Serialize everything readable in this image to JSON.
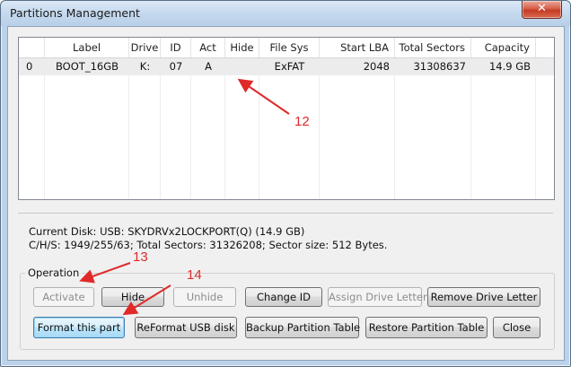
{
  "window": {
    "title": "Partitions Management",
    "close_glyph": "✕"
  },
  "table": {
    "columns": [
      "",
      "Label",
      "Drive",
      "ID",
      "Act",
      "Hide",
      "File Sys",
      "Start LBA",
      "Total Sectors",
      "Capacity"
    ],
    "rows": [
      {
        "index": "0",
        "label": "BOOT_16GB",
        "drive": "K:",
        "id": "07",
        "act": "A",
        "hide": "",
        "fs": "ExFAT",
        "start_lba": "2048",
        "total_sectors": "31308637",
        "capacity": "14.9 GB"
      }
    ]
  },
  "disk_info": {
    "line1": "Current Disk:  USB: SKYDRVx2LOCKPORT(Q) (14.9 GB)",
    "line2": "C/H/S: 1949/255/63; Total Sectors: 31326208; Sector size: 512 Bytes."
  },
  "operation": {
    "label": "Operation",
    "buttons_row1": {
      "activate": "Activate",
      "hide": "Hide",
      "unhide": "Unhide",
      "change_id": "Change ID",
      "assign_drive_letter": "Assign Drive Letter",
      "remove_drive_letter": "Remove Drive Letter"
    },
    "buttons_row2": {
      "format": "Format this part",
      "reformat": "ReFormat USB disk",
      "backup": "Backup Partition Table",
      "restore": "Restore Partition Table",
      "close": "Close"
    }
  },
  "annotations": {
    "a12": "12",
    "a13": "13",
    "a14": "14",
    "color": "#e02a2a"
  }
}
